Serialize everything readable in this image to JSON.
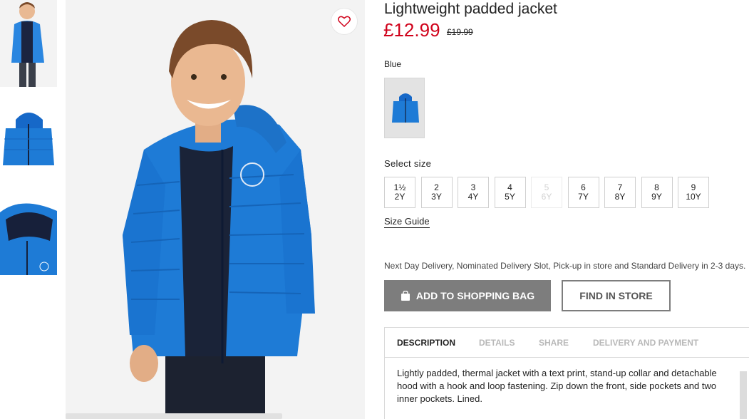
{
  "product": {
    "title": "Lightweight padded jacket",
    "price": "£12.99",
    "old_price": "£19.99"
  },
  "color": {
    "label": "Blue",
    "swatch_color": "#1E7BD6"
  },
  "size": {
    "label": "Select size",
    "options": [
      {
        "line1": "1½",
        "line2": "2Y",
        "available": true
      },
      {
        "line1": "2",
        "line2": "3Y",
        "available": true
      },
      {
        "line1": "3",
        "line2": "4Y",
        "available": true
      },
      {
        "line1": "4",
        "line2": "5Y",
        "available": true
      },
      {
        "line1": "5",
        "line2": "6Y",
        "available": false
      },
      {
        "line1": "6",
        "line2": "7Y",
        "available": true
      },
      {
        "line1": "7",
        "line2": "8Y",
        "available": true
      },
      {
        "line1": "8",
        "line2": "9Y",
        "available": true
      },
      {
        "line1": "9",
        "line2": "10Y",
        "available": true
      }
    ],
    "guide_label": "Size Guide"
  },
  "delivery_text": "Next Day Delivery, Nominated Delivery Slot, Pick-up in store and Standard Delivery in 2-3 days.",
  "actions": {
    "add_to_bag": "ADD TO SHOPPING BAG",
    "find_in_store": "FIND IN STORE"
  },
  "tabs": [
    {
      "label": "DESCRIPTION",
      "active": true
    },
    {
      "label": "DETAILS",
      "active": false
    },
    {
      "label": "SHARE",
      "active": false
    },
    {
      "label": "DELIVERY AND PAYMENT",
      "active": false
    }
  ],
  "description": "Lightly padded, thermal jacket with a text print, stand-up collar and detachable hood with a hook and loop fastening. Zip down the front, side pockets and two inner pockets. Lined.",
  "icons": {
    "favorite": "heart-icon",
    "bag": "shopping-bag-icon"
  },
  "colors": {
    "price_red": "#D0021B",
    "button_grey": "#7D7D7D",
    "jacket_blue": "#1E7BD6"
  }
}
